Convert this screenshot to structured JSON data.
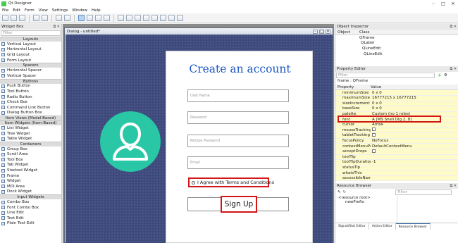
{
  "app": {
    "title": "Qt Designer"
  },
  "menu": [
    "File",
    "Edit",
    "Form",
    "View",
    "Settings",
    "Window",
    "Help"
  ],
  "widget_box": {
    "title": "Widget Box",
    "filter_placeholder": "Filter",
    "categories": [
      {
        "name": "Layouts",
        "items": [
          "Vertical Layout",
          "Horizontal Layout",
          "Grid Layout",
          "Form Layout"
        ]
      },
      {
        "name": "Spacers",
        "items": [
          "Horizontal Spacer",
          "Vertical Spacer"
        ]
      },
      {
        "name": "Buttons",
        "items": [
          "Push Button",
          "Tool Button",
          "Radio Button",
          "Check Box",
          "Command Link Button",
          "Dialog Button Box"
        ]
      },
      {
        "name": "Item Views (Model-Based)",
        "items": []
      },
      {
        "name": "Item Widgets (Item-Based)",
        "items": [
          "List Widget",
          "Tree Widget",
          "Table Widget"
        ]
      },
      {
        "name": "Containers",
        "items": [
          "Group Box",
          "Scroll Area",
          "Tool Box",
          "Tab Widget",
          "Stacked Widget",
          "Frame",
          "Widget",
          "MDI Area",
          "Dock Widget"
        ]
      },
      {
        "name": "Input Widgets",
        "items": [
          "Combo Box",
          "Font Combo Box",
          "Line Edit",
          "Text Edit",
          "Plain Text Edit"
        ]
      }
    ]
  },
  "form": {
    "title": "Dialog - untitled*",
    "heading": "Create an account",
    "fields": [
      {
        "placeholder": "User Name"
      },
      {
        "placeholder": "Password"
      },
      {
        "placeholder": "Retype Password"
      },
      {
        "placeholder": "Email"
      }
    ],
    "checkbox_label": "I Agree with Terms and Conditions",
    "signup_label": "Sign Up",
    "avatar_color": "#29c7a6",
    "canvas_color": "#3f4a7c"
  },
  "object_inspector": {
    "title": "Object Inspector",
    "columns": [
      "Object",
      "Class"
    ],
    "rows": [
      {
        "object": "",
        "class": "QFrame"
      },
      {
        "object": "",
        "class": "QLabel"
      },
      {
        "object": "",
        "class": "QLineEdit"
      },
      {
        "object": "",
        "class": "QLineEdit"
      }
    ]
  },
  "property_editor": {
    "title": "Property Editor",
    "filter_placeholder": "Filter",
    "breadcrumb": "frame : QFrame",
    "columns": [
      "Property",
      "Value"
    ],
    "rows": [
      {
        "name": "minimumSize",
        "value": "0 x 0",
        "y": true
      },
      {
        "name": "maximumSize",
        "value": "16777215 x 16777215",
        "y": true
      },
      {
        "name": "sizeIncrement",
        "value": "0 x 0",
        "y": true
      },
      {
        "name": "baseSize",
        "value": "0 x 0",
        "y": true
      },
      {
        "name": "palette",
        "value": "Custom (no 1 roles)",
        "y": true
      },
      {
        "name": "font",
        "value": "A [MS Shell Dlg 2, 8]",
        "y": true
      },
      {
        "name": "cursor",
        "value": "Arrow",
        "y": true
      },
      {
        "name": "mouseTracking",
        "value": "",
        "check": true,
        "y": true
      },
      {
        "name": "tabletTracking",
        "value": "",
        "check": true,
        "y": true
      },
      {
        "name": "focusPolicy",
        "value": "NoFocus",
        "y": true
      },
      {
        "name": "contextMenuPoli...",
        "value": "DefaultContextMenu",
        "y": true
      },
      {
        "name": "acceptDrops",
        "value": "",
        "check": true,
        "y": true
      },
      {
        "name": "toolTip",
        "value": "",
        "y": true
      },
      {
        "name": "toolTipDuration",
        "value": "-1",
        "y": true
      },
      {
        "name": "statusTip",
        "value": "",
        "y": true
      },
      {
        "name": "whatsThis",
        "value": "",
        "y": true
      },
      {
        "name": "accessibleName",
        "value": "",
        "y": true
      }
    ],
    "tooltip": "[MS Shell Dlg 2, 8]"
  },
  "resource_browser": {
    "title": "Resource Browser",
    "filter_placeholder": "Filter",
    "tree": [
      "<resource root>",
      "newPrefix"
    ]
  },
  "bottom_tabs": [
    "Signal/Slot Editor",
    "Action Editor",
    "Resource Browser"
  ],
  "colors": {
    "highlight": "#d31515",
    "heading": "#1d57c4"
  }
}
